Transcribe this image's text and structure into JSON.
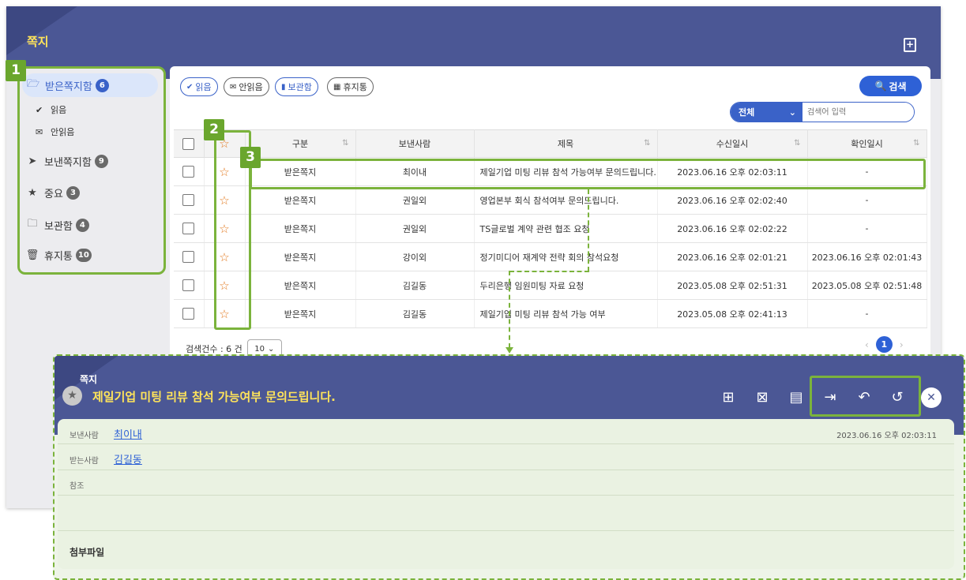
{
  "window": {
    "title": "쪽지",
    "new_icon": "new-message-icon"
  },
  "sidebar": {
    "items": [
      {
        "label": "받은쪽지함",
        "count": "6",
        "icon": "folder-open-icon"
      },
      {
        "label": "읽음",
        "icon": "check-icon"
      },
      {
        "label": "안읽음",
        "icon": "envelope-icon"
      },
      {
        "label": "보낸쪽지함",
        "count": "9",
        "icon": "send-icon"
      },
      {
        "label": "중요",
        "count": "3",
        "icon": "star-icon"
      },
      {
        "label": "보관함",
        "count": "4",
        "icon": "folder-icon"
      },
      {
        "label": "휴지통",
        "count": "10",
        "icon": "trash-icon"
      }
    ]
  },
  "callouts": [
    "1",
    "2",
    "3"
  ],
  "filters": [
    {
      "label": "읽음",
      "icon": "check-icon"
    },
    {
      "label": "안읽음",
      "icon": "envelope-icon"
    },
    {
      "label": "보관함",
      "icon": "folder-icon"
    },
    {
      "label": "휴지통",
      "icon": "trash-icon"
    }
  ],
  "search": {
    "button": "검색",
    "scope": "전체",
    "placeholder": "검색어 입력"
  },
  "table": {
    "headers": [
      "구분",
      "보낸사람",
      "제목",
      "수신일시",
      "확인일시"
    ],
    "rows": [
      {
        "type": "받은쪽지",
        "sender": "최이내",
        "subject": "제일기업 미팅 리뷰 참석 가능여부 문의드립니다.",
        "received": "2023.06.16 오후 02:03:11",
        "checked": "-"
      },
      {
        "type": "받은쪽지",
        "sender": "권일외",
        "subject": "영업본부 회식 참석여부 문의드립니다.",
        "received": "2023.06.16 오후 02:02:40",
        "checked": "-"
      },
      {
        "type": "받은쪽지",
        "sender": "권일외",
        "subject": "TS글로벌 계약 관련 협조 요청",
        "received": "2023.06.16 오후 02:02:22",
        "checked": "-"
      },
      {
        "type": "받은쪽지",
        "sender": "강이외",
        "subject": "정기미디어 재계약 전략 회의 참석요청",
        "received": "2023.06.16 오후 02:01:21",
        "checked": "2023.06.16 오후 02:01:43"
      },
      {
        "type": "받은쪽지",
        "sender": "김길동",
        "subject": "두리은행 임원미팅 자료 요청",
        "received": "2023.05.08 오후 02:51:31",
        "checked": "2023.05.08 오후 02:51:48"
      },
      {
        "type": "받은쪽지",
        "sender": "김길동",
        "subject": "제일기업 미팅 리뷰 참석 가능 여부",
        "received": "2023.05.08 오후 02:41:13",
        "checked": "-"
      }
    ]
  },
  "footer": {
    "count_label": "검색건수 : 6 건",
    "page_size": "10",
    "current_page": "1"
  },
  "message": {
    "label": "쪽지",
    "title": "제일기업 미팅 리뷰 참석 가능여부 문의드립니다.",
    "sender_key": "보낸사람",
    "sender": "최이내",
    "date": "2023.06.16 오후 02:03:11",
    "recipient_key": "받는사람",
    "recipient": "김길동",
    "cc_key": "참조",
    "attach_key": "첨부파일"
  },
  "colors": {
    "header": "#4b5795",
    "accent": "#2e61d6",
    "title": "#ffe45a",
    "highlight": "#7bb33c"
  }
}
